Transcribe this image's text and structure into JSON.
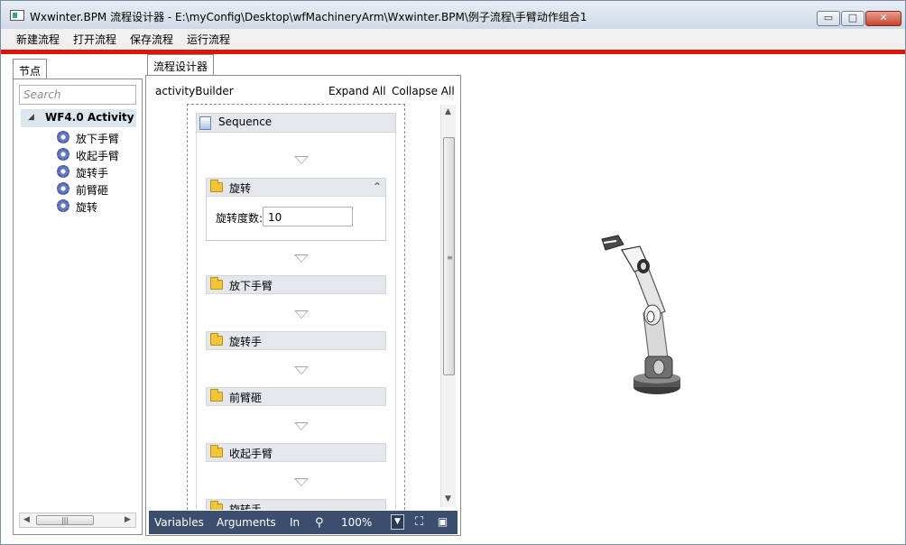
{
  "window": {
    "title": "Wxwinter.BPM 流程设计器  -   E:\\myConfig\\Desktop\\wfMachineryArm\\Wxwinter.BPM\\例子流程\\手臂动作组合1",
    "controls": {
      "minimize": "▭",
      "maximize": "□",
      "close": "✕"
    }
  },
  "menu": {
    "items": [
      "新建流程",
      "打开流程",
      "保存流程",
      "运行流程"
    ]
  },
  "colors": {
    "accent_bar": "#e3120b",
    "statusbar": "#3c4e6e"
  },
  "toolbox": {
    "tab": "节点",
    "search_placeholder": "Search",
    "root": "WF4.0 Activity",
    "items": [
      "放下手臂",
      "收起手臂",
      "旋转手",
      "前臂砸",
      "旋转"
    ]
  },
  "designer": {
    "tab": "流程设计器",
    "breadcrumb": "activityBuilder",
    "expand_all": "Expand All",
    "collapse_all": "Collapse All",
    "sequence_label": "Sequence",
    "expanded_activity": {
      "label": "旋转",
      "property_label": "旋转度数:",
      "property_value": "10"
    },
    "activities": [
      "放下手臂",
      "旋转手",
      "前臂砸",
      "收起手臂",
      "旋转手"
    ]
  },
  "statusbar": {
    "variables": "Variables",
    "arguments": "Arguments",
    "imports": "In",
    "zoom": "100%"
  }
}
